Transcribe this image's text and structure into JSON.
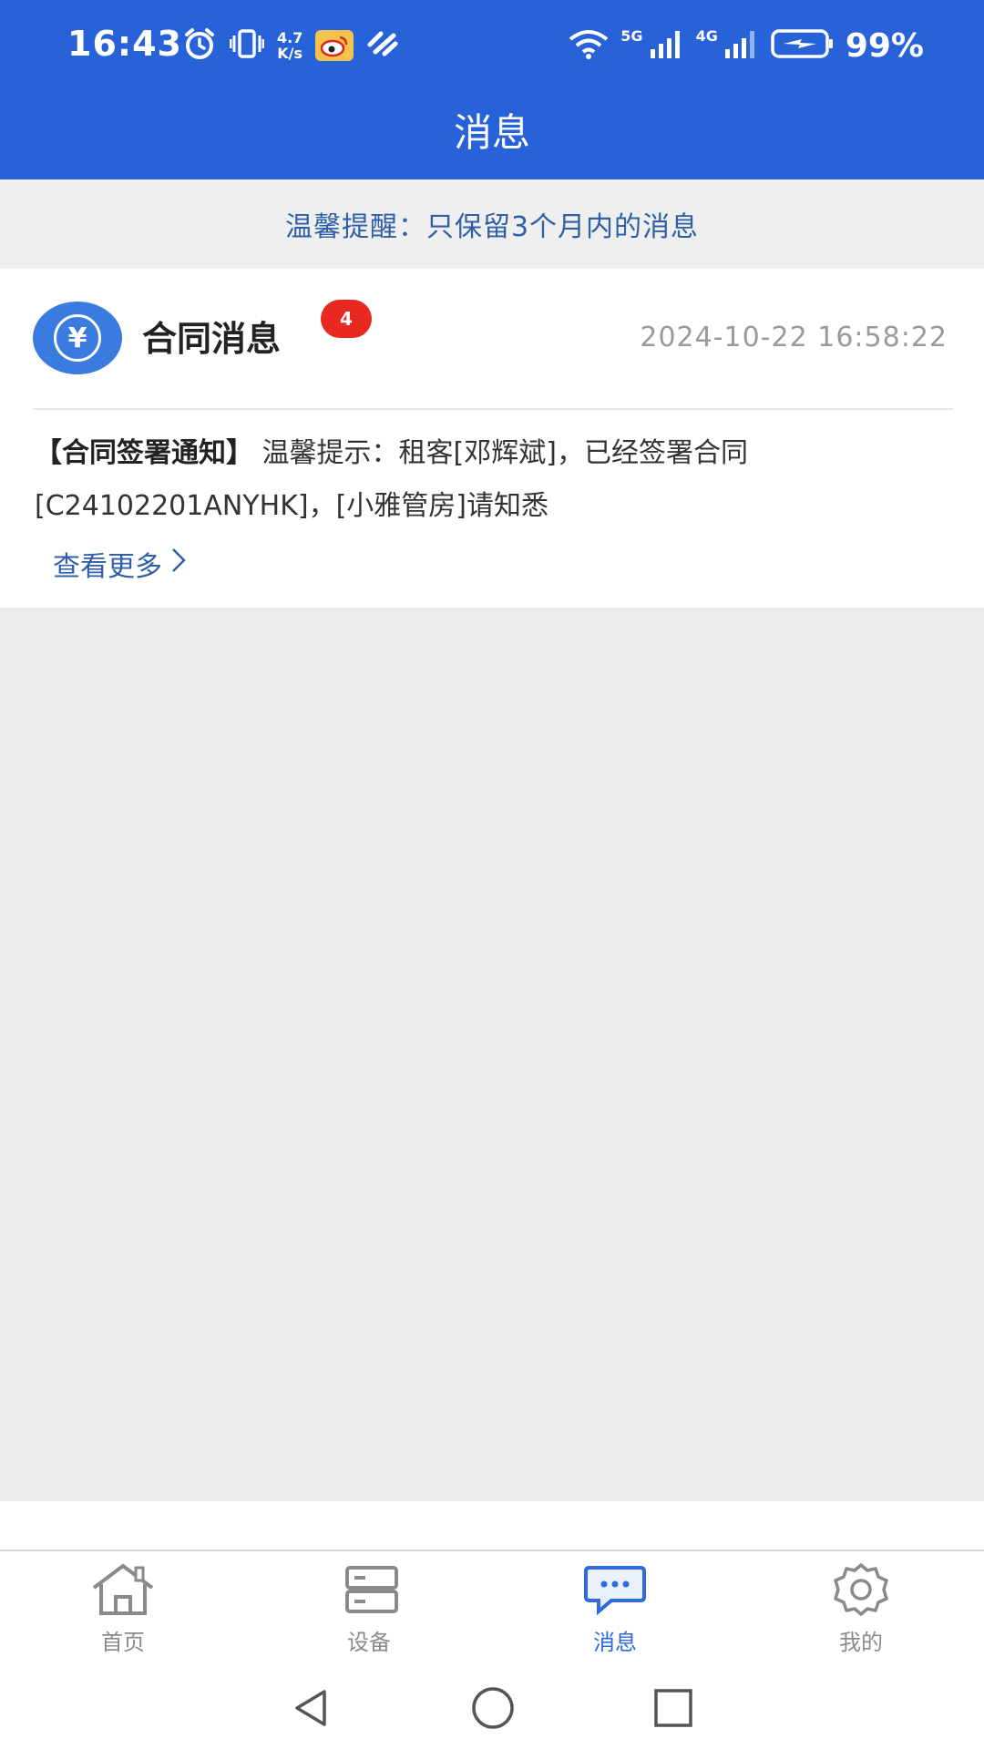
{
  "status_bar": {
    "time": "16:43",
    "speed_value": "4.7",
    "speed_unit": "K/s",
    "net1": "5G",
    "net2": "4G",
    "battery": "99%"
  },
  "header": {
    "title": "消息"
  },
  "tip": {
    "text": "温馨提醒：只保留3个月内的消息"
  },
  "message_card": {
    "icon_symbol": "¥",
    "title": "合同消息",
    "unread_count": "4",
    "timestamp": "2024-10-22 16:58:22",
    "body_tag": "【合同签署通知】",
    "body_text": " 温馨提示：租客[邓辉斌]，已经签署合同[C24102201ANYHK]，[小雅管房]请知悉",
    "view_more": "查看更多"
  },
  "tabs": [
    {
      "label": "首页",
      "icon": "home-icon",
      "active": false
    },
    {
      "label": "设备",
      "icon": "device-icon",
      "active": false
    },
    {
      "label": "消息",
      "icon": "message-icon",
      "active": true
    },
    {
      "label": "我的",
      "icon": "gear-icon",
      "active": false
    }
  ],
  "colors": {
    "primary": "#2762d8",
    "accent_text": "#2f5fa6",
    "badge": "#e8291f",
    "tab_active": "#2e6be0"
  }
}
